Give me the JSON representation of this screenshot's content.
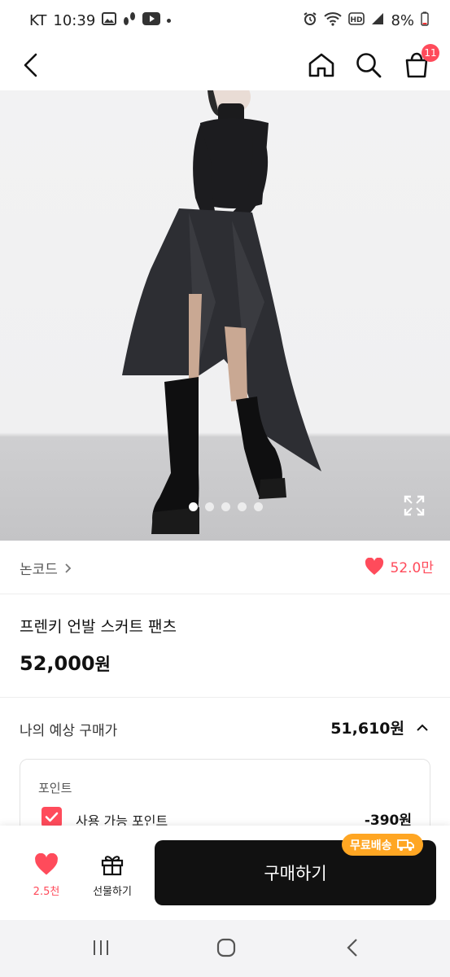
{
  "status_bar": {
    "carrier": "KT",
    "time": "10:39",
    "battery": "8%"
  },
  "header": {
    "cart_count": "11"
  },
  "gallery": {
    "current_index": 1,
    "total": 5
  },
  "brand": {
    "name": "논코드",
    "likes": "52.0만"
  },
  "product": {
    "title": "프렌키 언발 스커트 팬츠",
    "price": "52,000",
    "price_unit": "원"
  },
  "estimate": {
    "label": "나의 예상 구매가",
    "value": "51,610원"
  },
  "points": {
    "section_label": "포인트",
    "checkbox_label": "사용 가능 포인트",
    "amount": "-390원"
  },
  "bottom_bar": {
    "wish_count": "2.5천",
    "gift_label": "선물하기",
    "buy_label": "구매하기",
    "free_shipping_badge": "무료배송"
  },
  "colors": {
    "accent": "#ff4b5b",
    "buy_button": "#111111",
    "shipping_badge": "#ffa623"
  }
}
